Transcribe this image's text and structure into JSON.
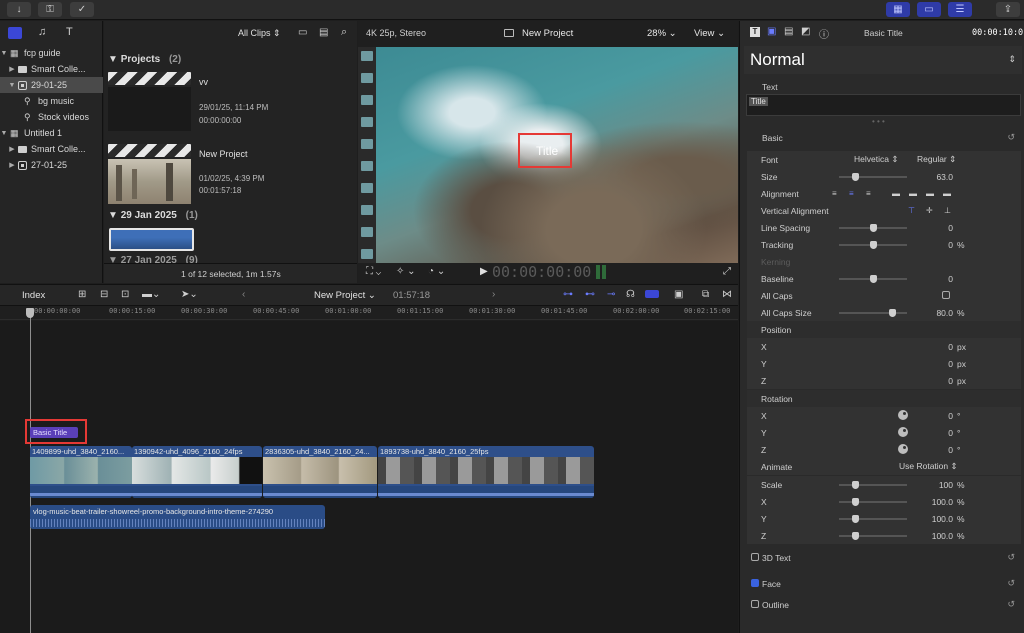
{
  "toolbar": {
    "colors": {
      "accent": "#2f3ba8",
      "highlight": "#e53935"
    }
  },
  "library": {
    "items": [
      {
        "label": "fcp guide"
      },
      {
        "label": "Smart Colle..."
      },
      {
        "label": "29-01-25"
      },
      {
        "label": "bg music"
      },
      {
        "label": "Stock videos"
      },
      {
        "label": "Untitled 1"
      },
      {
        "label": "Smart Colle..."
      },
      {
        "label": "27-01-25"
      }
    ]
  },
  "browser": {
    "filter_label": "All Clips",
    "projects_header": "Projects",
    "projects_count": "(2)",
    "clips": [
      {
        "name": "vv",
        "date": "29/01/25, 11:14 PM",
        "duration": "00:00:00:00"
      },
      {
        "name": "New Project",
        "date": "01/02/25, 4:39 PM",
        "duration": "00:01:57:18"
      }
    ],
    "group_header": "29 Jan 2025",
    "group_count": "(1)",
    "group2_header": "27 Jan 2025",
    "group2_count": "(9)",
    "status": "1 of 12 selected, 1m 1.57s"
  },
  "viewer": {
    "format": "4K 25p, Stereo",
    "project_name": "New Project",
    "zoom": "28%",
    "view_label": "View",
    "title_text": "Title",
    "timecode": "00:00:00:00"
  },
  "timeline": {
    "index_label": "Index",
    "project_name": "New Project",
    "duration": "01:57:18",
    "ruler_ticks": [
      "00:00:00:00",
      "00:00:15:00",
      "00:00:30:00",
      "00:00:45:00",
      "00:01:00:00",
      "00:01:15:00",
      "00:01:30:00",
      "00:01:45:00",
      "00:02:00:00",
      "00:02:15:00"
    ],
    "title_clip": "Basic Title",
    "video_clips": [
      {
        "name": "1409899-uhd_3840_2160..."
      },
      {
        "name": "1390942-uhd_4096_2160_24fps"
      },
      {
        "name": "2836305-uhd_3840_2160_24..."
      },
      {
        "name": "1893738-uhd_3840_2160_25fps"
      }
    ],
    "audio_clip": "vlog-music-beat-trailer-showreel-promo-background-intro-theme-274290"
  },
  "inspector": {
    "header_title": "Basic Title",
    "header_time": "00:00:10:01",
    "preset": "Normal",
    "text_label": "Text",
    "text_value": "Title",
    "basic_section": "Basic",
    "font_label": "Font",
    "font_family": "Helvetica",
    "font_style": "Regular",
    "size_label": "Size",
    "size_value": "63.0",
    "alignment_label": "Alignment",
    "valign_label": "Vertical Alignment",
    "line_spacing_label": "Line Spacing",
    "line_spacing_value": "0",
    "tracking_label": "Tracking",
    "tracking_value": "0",
    "tracking_unit": "%",
    "kerning_label": "Kerning",
    "baseline_label": "Baseline",
    "baseline_value": "0",
    "allcaps_label": "All Caps",
    "allcaps_size_label": "All Caps Size",
    "allcaps_size_value": "80.0",
    "allcaps_size_unit": "%",
    "position_label": "Position",
    "pos_x": "0",
    "pos_y": "0",
    "pos_z": "0",
    "pos_unit": "px",
    "rotation_label": "Rotation",
    "rot_x": "0",
    "rot_y": "0",
    "rot_z": "0",
    "rot_unit": "°",
    "animate_label": "Animate",
    "animate_value": "Use Rotation",
    "scale_label": "Scale",
    "scale_all": "100",
    "scale_x": "100.0",
    "scale_y": "100.0",
    "scale_z": "100.0",
    "scale_unit": "%",
    "x_label": "X",
    "y_label": "Y",
    "z_label": "Z",
    "threed_text_label": "3D Text",
    "face_label": "Face",
    "outline_label": "Outline"
  }
}
